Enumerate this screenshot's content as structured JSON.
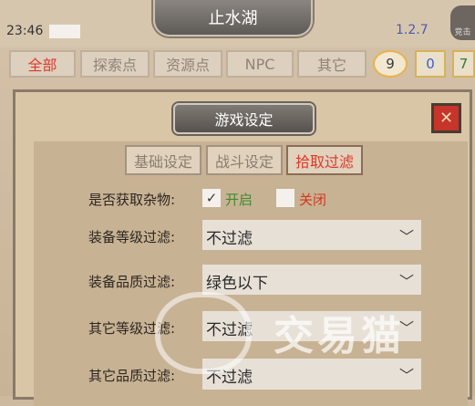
{
  "header": {
    "location": "止水湖",
    "time": "23:46",
    "version": "1.2.7",
    "avatar_label": "竞击"
  },
  "filter_tabs": [
    {
      "label": "全部",
      "active": true
    },
    {
      "label": "探索点",
      "active": false
    },
    {
      "label": "资源点",
      "active": false
    },
    {
      "label": "NPC",
      "active": false
    },
    {
      "label": "其它",
      "active": false
    }
  ],
  "counters": {
    "first": "9",
    "second": "0",
    "third": "7"
  },
  "dialog": {
    "title": "游戏设定",
    "close_icon": "close-icon",
    "tabs": [
      {
        "label": "基础设定",
        "active": false
      },
      {
        "label": "战斗设定",
        "active": false
      },
      {
        "label": "拾取过滤",
        "active": true
      }
    ],
    "misc_pickup": {
      "label": "是否获取杂物:",
      "on_label": "开启",
      "off_label": "关闭",
      "on_checked": true
    },
    "filters": [
      {
        "label": "装备等级过滤:",
        "value": "不过滤"
      },
      {
        "label": "装备品质过滤:",
        "value": "绿色以下"
      },
      {
        "label": "其它等级过滤:",
        "value": "不过滤"
      },
      {
        "label": "其它品质过滤:",
        "value": "不过滤"
      }
    ]
  },
  "watermark": "交易猫",
  "colors": {
    "active_tab_text": "#e03a2a",
    "on_text": "#3f8a2c",
    "off_text": "#d2361f",
    "version_text": "#4b5bb0"
  }
}
